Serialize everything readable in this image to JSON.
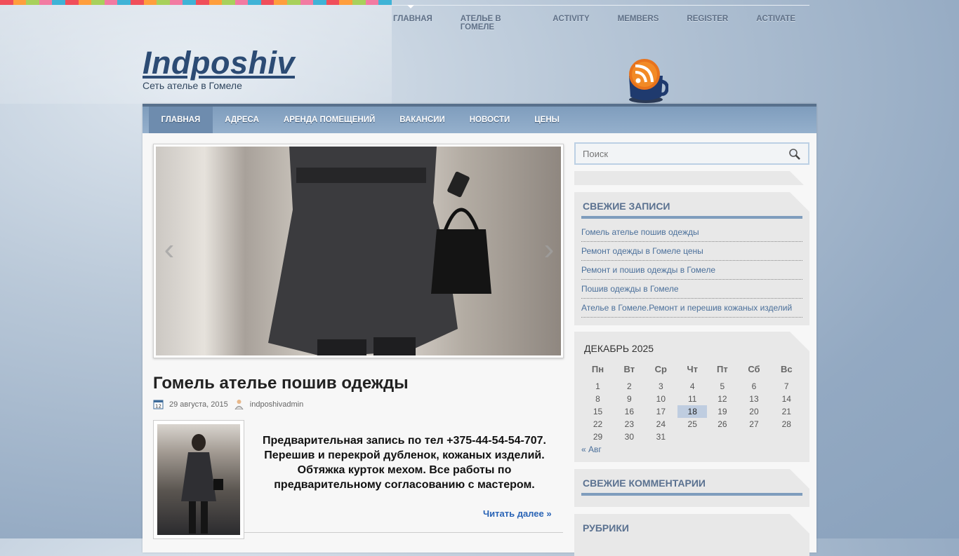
{
  "colors": {
    "stripe": [
      "#f04e5a",
      "#ff9e3d",
      "#a8d05b",
      "#f27ba2",
      "#3fb3d6",
      "#f04e5a",
      "#ff9e3d",
      "#a8d05b",
      "#f27ba2",
      "#3fb3d6",
      "#f04e5a",
      "#ff9e3d",
      "#a8d05b",
      "#f27ba2",
      "#3fb3d6",
      "#f04e5a",
      "#ff9e3d",
      "#a8d05b",
      "#f27ba2",
      "#3fb3d6",
      "#f04e5a",
      "#ff9e3d",
      "#a8d05b",
      "#f27ba2",
      "#3fb3d6",
      "#f04e5a",
      "#ff9e3d",
      "#a8d05b",
      "#f27ba2",
      "#3fb3d6"
    ],
    "accent": "#7f9dbd",
    "link": "#4a6f9a"
  },
  "topnav": {
    "items": [
      {
        "label": "ГЛАВНАЯ"
      },
      {
        "label": "АТЕЛЬЕ В ГОМЕЛЕ"
      },
      {
        "label": "ACTIVITY"
      },
      {
        "label": "MEMBERS"
      },
      {
        "label": "REGISTER"
      },
      {
        "label": "ACTIVATE"
      }
    ]
  },
  "header": {
    "title": "Indposhiv",
    "description": "Сеть ателье в Гомеле",
    "rss_icon": "rss-cup-icon"
  },
  "mainnav": {
    "items": [
      {
        "label": "ГЛАВНАЯ"
      },
      {
        "label": "АДРЕСА"
      },
      {
        "label": "АРЕНДА ПОМЕЩЕНИЙ"
      },
      {
        "label": "ВАКАНСИИ"
      },
      {
        "label": "НОВОСТИ"
      },
      {
        "label": "ЦЕНЫ"
      }
    ]
  },
  "slider": {
    "prev": "‹",
    "next": "›"
  },
  "post": {
    "title": "Гомель ателье пошив одежды",
    "date": "29 августа, 2015",
    "author": "indposhivadmin",
    "excerpt": "Предварительная запись по тел +375-44-54-54-707. Перешив и перекрой дубленок, кожаных изделий. Обтяжка курток мехом. Все работы по предварительному согласованию с мастером.",
    "read_more": "Читать далее »"
  },
  "sidebar": {
    "search_placeholder": "Поиск",
    "recent_posts": {
      "title": "СВЕЖИЕ ЗАПИСИ",
      "items": [
        "Гомель ателье пошив одежды",
        "Ремонт одежды в Гомеле цены",
        "Ремонт и пошив одежды в Гомеле",
        "Пошив одежды в Гомеле",
        "Ателье в Гомеле.Ремонт и перешив кожаных изделий"
      ]
    },
    "calendar": {
      "title": "ДЕКАБРЬ 2025",
      "days": [
        "Пн",
        "Вт",
        "Ср",
        "Чт",
        "Пт",
        "Сб",
        "Вс"
      ],
      "weeks": [
        [
          "1",
          "2",
          "3",
          "4",
          "5",
          "6",
          "7"
        ],
        [
          "8",
          "9",
          "10",
          "11",
          "12",
          "13",
          "14"
        ],
        [
          "15",
          "16",
          "17",
          "18",
          "19",
          "20",
          "21"
        ],
        [
          "22",
          "23",
          "24",
          "25",
          "26",
          "27",
          "28"
        ],
        [
          "29",
          "30",
          "31",
          "",
          "",
          "",
          ""
        ]
      ],
      "today": "18",
      "prev": "« Авг"
    },
    "recent_comments": {
      "title": "СВЕЖИЕ КОММЕНТАРИИ"
    },
    "categories": {
      "title": "РУБРИКИ"
    }
  }
}
